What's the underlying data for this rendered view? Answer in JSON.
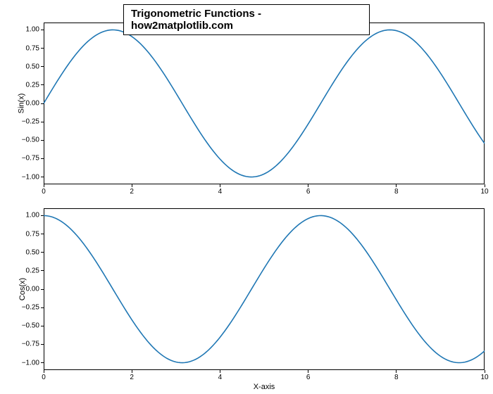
{
  "suptitle": "Trigonometric Functions - how2matplotlib.com",
  "colors": {
    "line": "#1f77b4"
  },
  "axes": {
    "x_range": [
      0,
      10
    ],
    "x_ticks": [
      0,
      2,
      4,
      6,
      8,
      10
    ],
    "y_range": [
      -1,
      1
    ],
    "y_ticks": [
      -1.0,
      -0.75,
      -0.5,
      -0.25,
      0.0,
      0.25,
      0.5,
      0.75,
      1.0
    ],
    "y_pad": 0.05
  },
  "top": {
    "ylabel": "Sin(x)",
    "xlabel": "",
    "series_key": "sin"
  },
  "bottom": {
    "ylabel": "Cos(x)",
    "xlabel": "X-axis",
    "series_key": "cos"
  },
  "chart_data": [
    {
      "type": "line",
      "name": "sin",
      "title": "Sin(x)",
      "xlabel": "",
      "ylabel": "Sin(x)",
      "xlim": [
        0,
        10
      ],
      "ylim": [
        -1,
        1
      ],
      "x": [
        0,
        0.5,
        1,
        1.5,
        2,
        2.5,
        3,
        3.5,
        4,
        4.5,
        5,
        5.5,
        6,
        6.5,
        7,
        7.5,
        8,
        8.5,
        9,
        9.5,
        10
      ],
      "y": [
        0.0,
        0.4794,
        0.8415,
        0.9975,
        0.9093,
        0.5985,
        0.1411,
        -0.3508,
        -0.7568,
        -0.9775,
        -0.9589,
        -0.7055,
        -0.2794,
        0.2151,
        0.657,
        0.938,
        0.9894,
        0.7985,
        0.4121,
        -0.0752,
        -0.544
      ]
    },
    {
      "type": "line",
      "name": "cos",
      "title": "Cos(x)",
      "xlabel": "X-axis",
      "ylabel": "Cos(x)",
      "xlim": [
        0,
        10
      ],
      "ylim": [
        -1,
        1
      ],
      "x": [
        0,
        0.5,
        1,
        1.5,
        2,
        2.5,
        3,
        3.5,
        4,
        4.5,
        5,
        5.5,
        6,
        6.5,
        7,
        7.5,
        8,
        8.5,
        9,
        9.5,
        10
      ],
      "y": [
        1.0,
        0.8776,
        0.5403,
        0.0707,
        -0.4161,
        -0.8011,
        -0.99,
        -0.9365,
        -0.6536,
        -0.2108,
        0.2837,
        0.7087,
        0.9602,
        0.9766,
        0.7539,
        0.3466,
        -0.1455,
        -0.602,
        -0.9111,
        -0.9972,
        -0.8391
      ]
    }
  ]
}
